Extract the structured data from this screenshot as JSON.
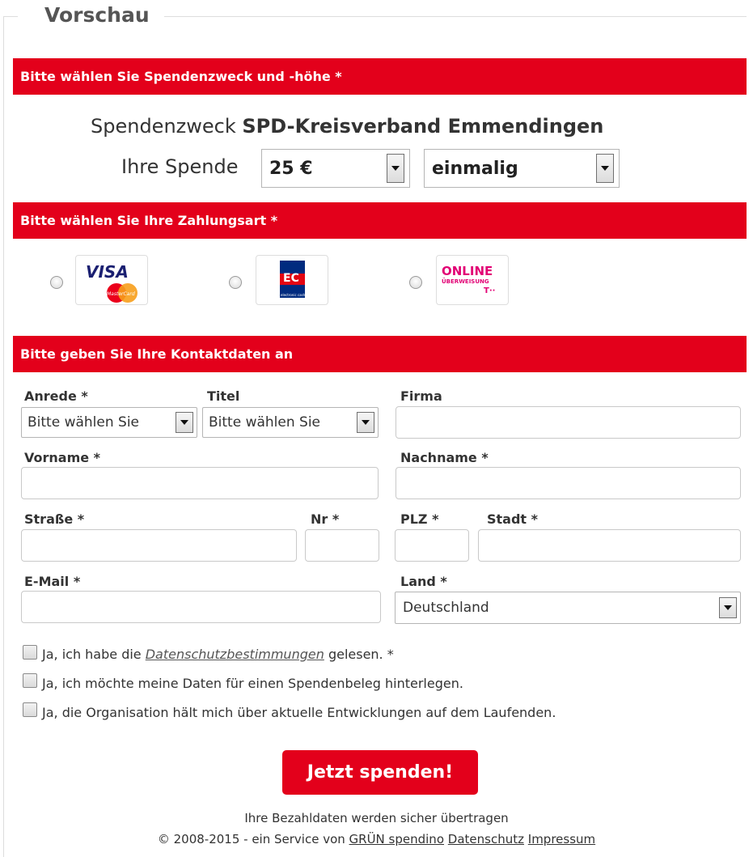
{
  "legend": "Vorschau",
  "sections": {
    "purpose": "Bitte wählen Sie Spendenzweck und -höhe *",
    "payment": "Bitte wählen Sie Ihre Zahlungsart *",
    "contact": "Bitte geben Sie Ihre Kontaktdaten an"
  },
  "donation": {
    "purpose_label": "Spendenzweck",
    "purpose_value": "SPD-Kreisverband Emmendingen",
    "amount_label": "Ihre Spende",
    "amount_value": "25 €",
    "frequency_value": "einmalig"
  },
  "payment_methods": {
    "visa_text": "VISA",
    "mastercard_text": "MasterCard",
    "ec_text": "EC",
    "ec_sub": "electronic cash",
    "online_line1": "ONLINE",
    "online_line2": "ÜBERWEISUNG",
    "online_brand": "T··"
  },
  "contact": {
    "anrede_label": "Anrede *",
    "anrede_value": "Bitte wählen Sie",
    "titel_label": "Titel",
    "titel_value": "Bitte wählen Sie",
    "firma_label": "Firma",
    "vorname_label": "Vorname *",
    "nachname_label": "Nachname *",
    "strasse_label": "Straße *",
    "nr_label": "Nr *",
    "plz_label": "PLZ *",
    "stadt_label": "Stadt *",
    "email_label": "E-Mail *",
    "land_label": "Land *",
    "land_value": "Deutschland"
  },
  "checkboxes": {
    "privacy_pre": "Ja, ich habe die ",
    "privacy_link": "Datenschutzbestimmungen",
    "privacy_post": " gelesen. *",
    "receipt": "Ja, ich möchte meine Daten für einen Spendenbeleg hinterlegen.",
    "updates": "Ja, die Organisation hält mich über aktuelle Entwicklungen auf dem Laufenden."
  },
  "submit_label": "Jetzt spenden!",
  "footer": {
    "secure": "Ihre Bezahldaten werden sicher übertragen",
    "copyright": "© 2008-2015 - ein Service von ",
    "brand_link": "GRÜN spendino",
    "privacy_link": "Datenschutz",
    "imprint_link": "Impressum"
  },
  "colors": {
    "accent": "#e3001b"
  }
}
